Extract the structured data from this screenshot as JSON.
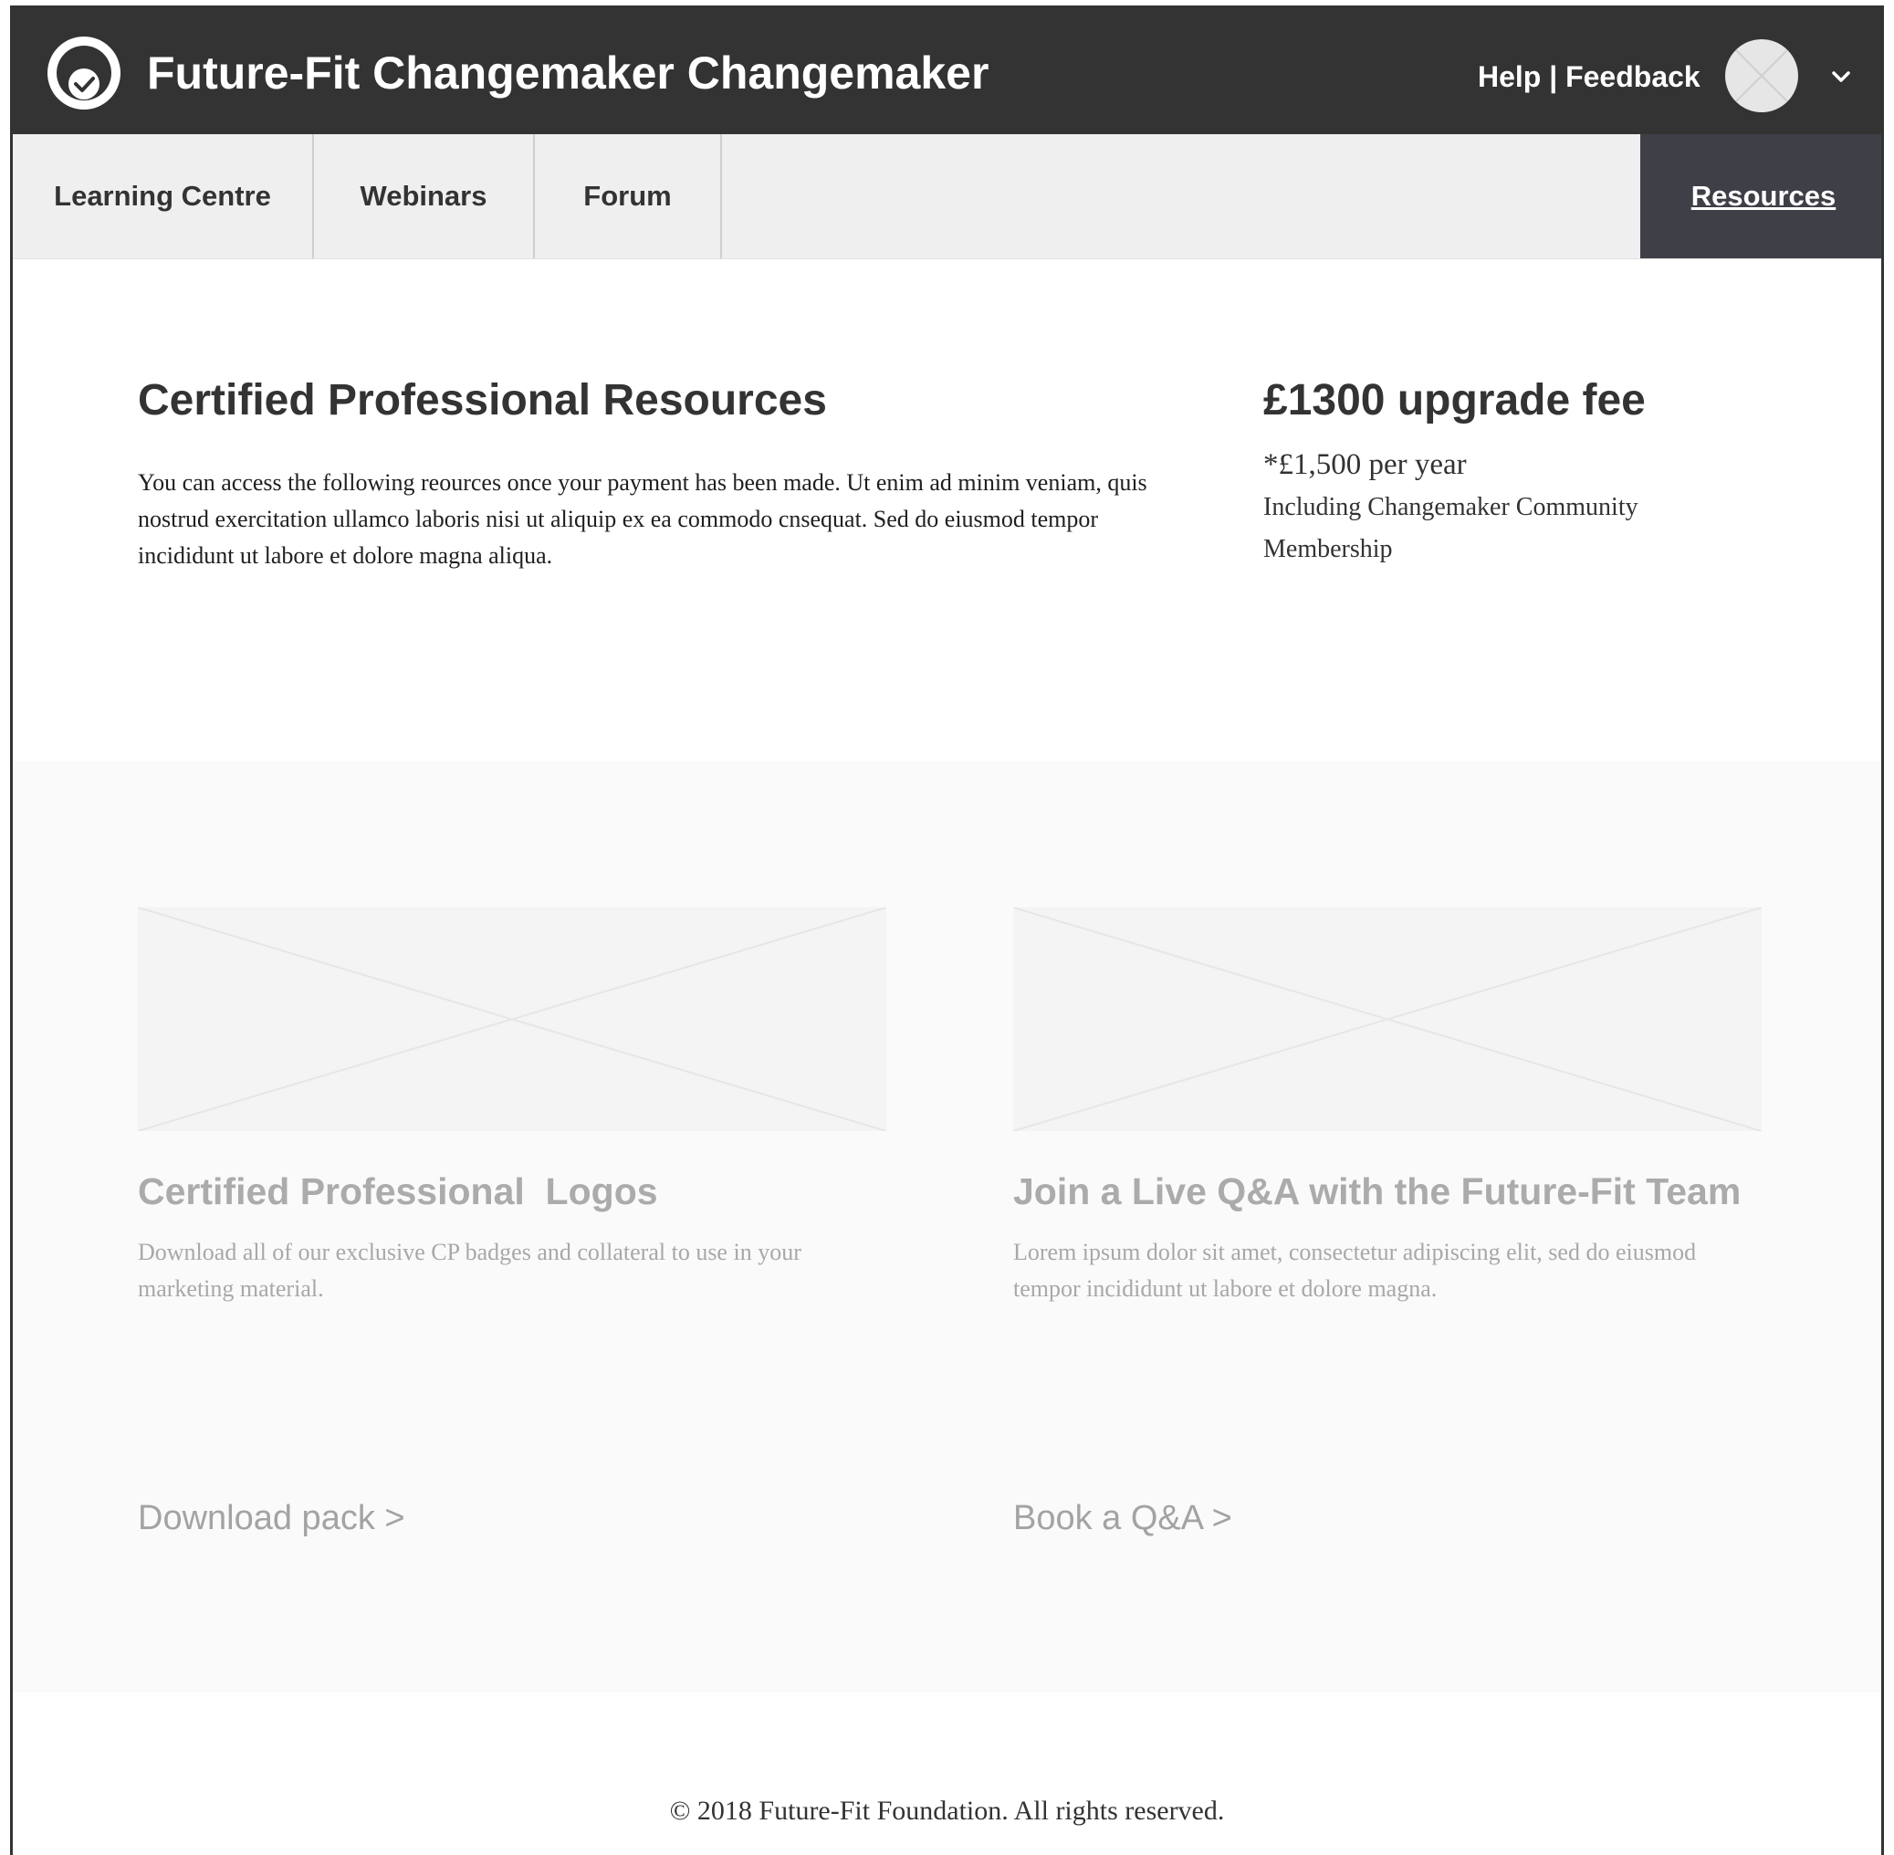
{
  "header": {
    "title": "Future-Fit Changemaker Changemaker",
    "help_label": "Help",
    "separator": "|",
    "feedback_label": "Feedback",
    "logo_icon": "check-circle-logo-icon",
    "avatar_icon": "avatar-placeholder-icon",
    "menu_icon": "chevron-down-icon"
  },
  "nav": {
    "items": [
      {
        "label": "Learning Centre",
        "active": false
      },
      {
        "label": "Webinars",
        "active": false
      },
      {
        "label": "Forum",
        "active": false
      },
      {
        "label": "Resources",
        "active": true
      }
    ]
  },
  "intro": {
    "title": "Certified Professional Resources",
    "body": "You can access the following reources once your payment has been made. Ut enim ad minim veniam, quis nostrud exercitation ullamco laboris nisi ut aliquip ex ea commodo cnsequat. Sed do eiusmod tempor incididunt ut labore et dolore magna aliqua."
  },
  "fee": {
    "title": "£1300 upgrade fee",
    "per_year": "*£1,500 per year",
    "note": "Including Changemaker Community Membership"
  },
  "cards": [
    {
      "title": "Certified Professional  Logos",
      "description": "Download all of our exclusive CP badges and collateral to use in your marketing material.",
      "link": "Download pack >",
      "image_icon": "image-placeholder-icon"
    },
    {
      "title": "Join a Live Q&A with the Future-Fit Team",
      "description": "Lorem ipsum dolor sit amet, consectetur adipiscing elit, sed do eiusmod tempor incididunt ut labore et dolore magna.",
      "link": "Book a Q&A >",
      "image_icon": "image-placeholder-icon"
    }
  ],
  "footer": {
    "text": "© 2018 Future-Fit Foundation. All rights reserved."
  },
  "colors": {
    "header_bg": "#333333",
    "nav_bg": "#efefef",
    "nav_active_bg": "#3f3f47",
    "cards_bg": "#fafafa",
    "muted_text": "#ababab"
  }
}
